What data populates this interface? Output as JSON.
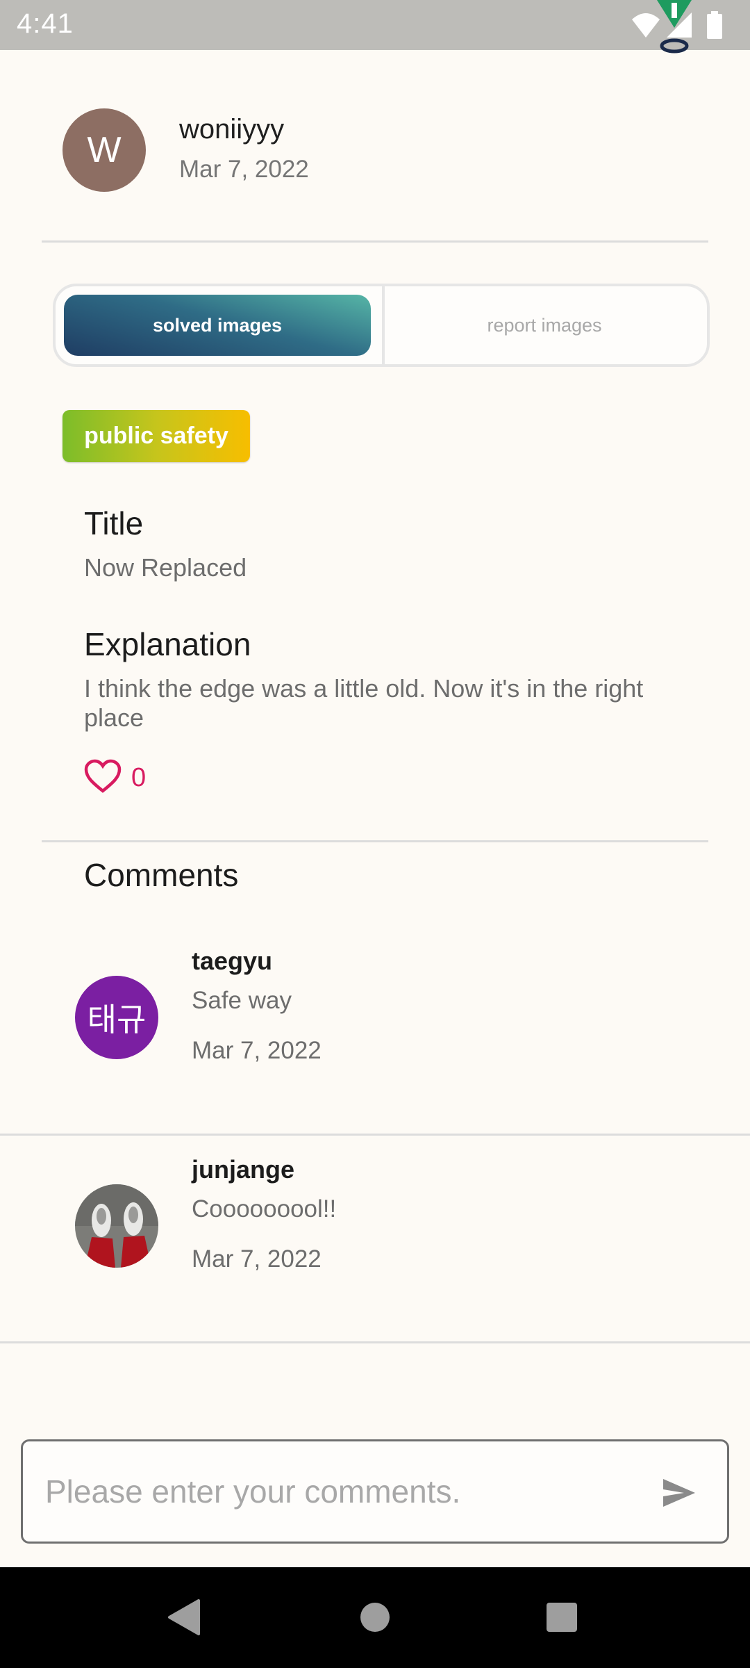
{
  "status_bar": {
    "time": "4:41"
  },
  "post": {
    "author": {
      "initial": "W",
      "name": "woniiyyy",
      "date": "Mar 7, 2022"
    },
    "tabs": {
      "active": "solved images",
      "inactive": "report images"
    },
    "category": "public safety",
    "title_label": "Title",
    "title_value": "Now Replaced",
    "explanation_label": "Explanation",
    "explanation_value": "I think the edge was a little old. Now it's in the right place",
    "likes": "0"
  },
  "comments": {
    "heading": "Comments",
    "items": [
      {
        "avatar_text": "태규",
        "author": "taegyu",
        "text": "Safe way",
        "date": "Mar 7, 2022"
      },
      {
        "avatar_text": "",
        "author": "junjange",
        "text": "Cooooooool!!",
        "date": "Mar 7, 2022"
      }
    ]
  },
  "comment_input": {
    "placeholder": "Please enter your comments."
  },
  "colors": {
    "accent_like": "#d81b60",
    "avatar_author": "#8d6e63",
    "avatar_taegyu": "#7b1fa2"
  },
  "icons": [
    "wifi-icon",
    "signal-icon",
    "battery-icon",
    "heart-icon",
    "send-icon",
    "nav-back-icon",
    "nav-home-icon",
    "nav-recents-icon"
  ]
}
